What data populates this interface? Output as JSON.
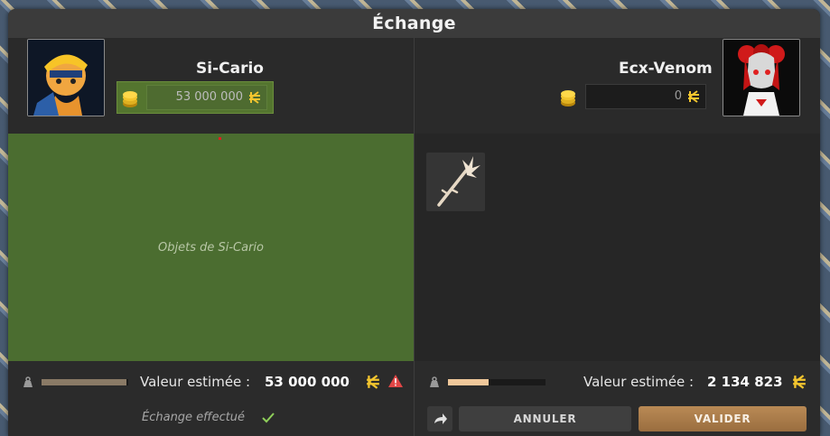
{
  "window": {
    "title": "Échange"
  },
  "left": {
    "player_name": "Si-Cario",
    "kamas_offer": "53 000 000",
    "items_empty_label": "Objets de Si-Cario",
    "pods_fraction": 0.98,
    "estimated_label": "Valeur estimée :",
    "estimated_value": "53 000 000",
    "status_text": "Échange effectué"
  },
  "right": {
    "player_name": "Ecx-Venom",
    "kamas_offer": "0",
    "items": [
      {
        "icon": "staff-icon"
      }
    ],
    "pods_fraction": 0.42,
    "estimated_label": "Valeur estimée :",
    "estimated_value": "2 134 823",
    "cancel_label": "ANNULER",
    "validate_label": "VALIDER"
  },
  "colors": {
    "left_panel": "#4b6d30",
    "validate_button": "#b98a55",
    "warning": "#e04646"
  }
}
